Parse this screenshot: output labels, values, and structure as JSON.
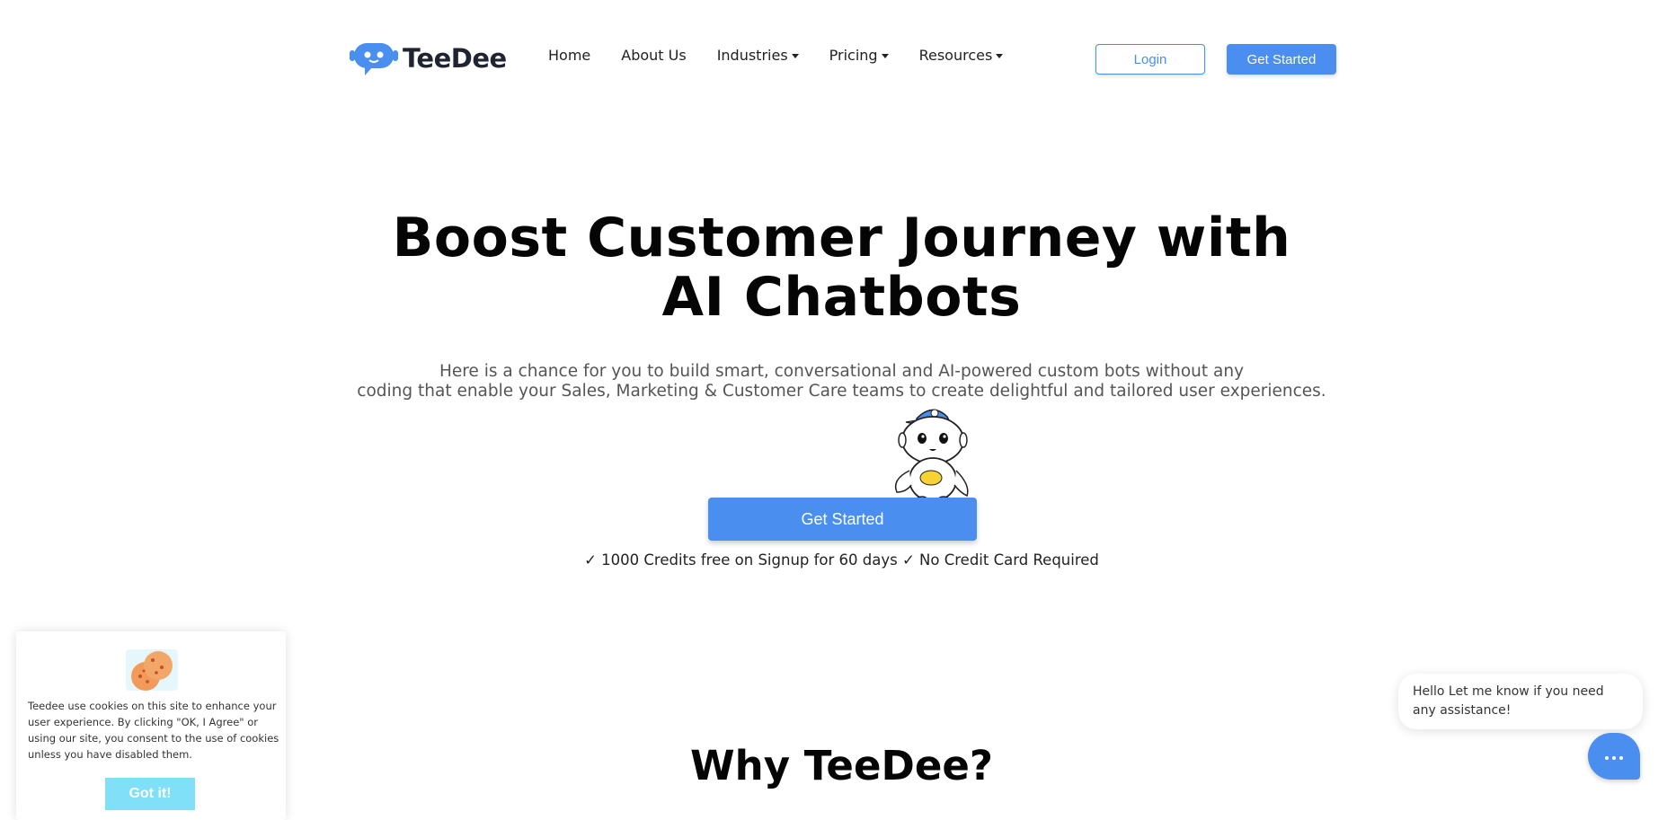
{
  "brand": {
    "name": "TeeDee",
    "primary_color": "#4a8ef0"
  },
  "nav": {
    "items": [
      {
        "label": "Home",
        "has_caret": false
      },
      {
        "label": "About Us",
        "has_caret": false
      },
      {
        "label": "Industries",
        "has_caret": true
      },
      {
        "label": "Pricing",
        "has_caret": true
      },
      {
        "label": "Resources",
        "has_caret": true
      }
    ],
    "login_label": "Login",
    "get_started_label": "Get Started"
  },
  "hero": {
    "title_line1": "Boost Customer Journey with",
    "title_line2": "AI Chatbots",
    "subtitle_line1": "Here is a chance for you to build smart, conversational and AI-powered custom bots without any",
    "subtitle_line2": "coding that enable your Sales, Marketing & Customer Care teams to create delightful and tailored user experiences.",
    "cta_label": "Get Started",
    "perks": "✓ 1000 Credits free on Signup for 60 days ✓ No Credit Card Required"
  },
  "why": {
    "title": "Why TeeDee?"
  },
  "cookie": {
    "text": "Teedee use cookies on this site to enhance your user experience. By clicking \"OK, I Agree\" or using our site, you consent to the use of cookies unless you have disabled them.",
    "button_label": "Got it!",
    "button_color": "#7fe0f8"
  },
  "chat": {
    "message": "Hello Let me know if you need any assistance!",
    "launcher_icon": "chat-dots-icon"
  }
}
